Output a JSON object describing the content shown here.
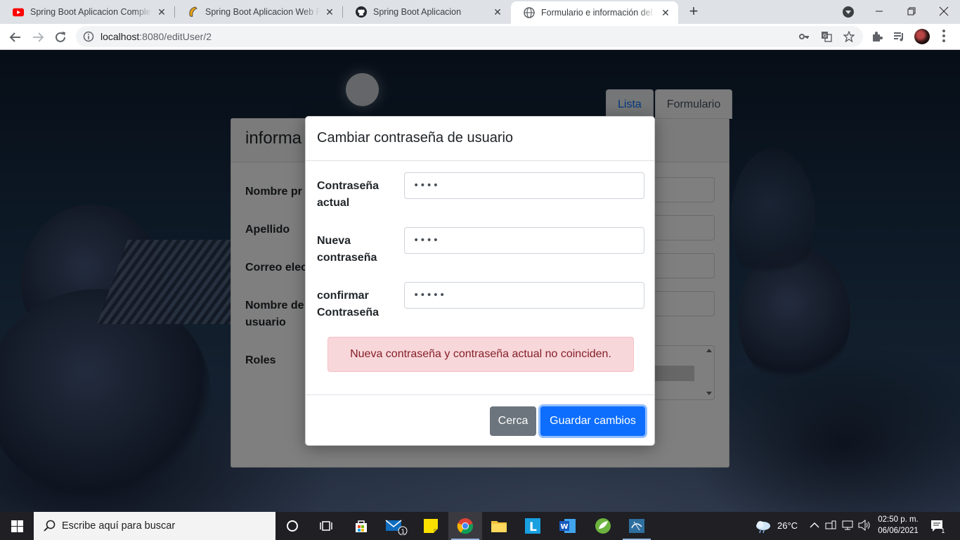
{
  "browser": {
    "tabs": [
      {
        "title": "Spring Boot Aplicacion Completa",
        "icon": "youtube-icon"
      },
      {
        "title": "Spring Boot Aplicacion Web Parte",
        "icon": "blog-icon"
      },
      {
        "title": "Spring Boot Aplicacion",
        "icon": "github-icon"
      },
      {
        "title": "Formulario e información del usuario",
        "icon": "globe-icon",
        "active": true
      }
    ],
    "url_host": "localhost",
    "url_rest": ":8080/editUser/2"
  },
  "page": {
    "tab_list": "Lista",
    "tab_form": "Formulario",
    "card_title": "informa",
    "fields": [
      "Nombre pr",
      "Apellido",
      "Correo elec",
      "Nombre de usuario",
      "Roles"
    ]
  },
  "modal": {
    "title": "Cambiar contraseña de usuario",
    "current_label": "Contraseña actual",
    "current_value": "••••",
    "new_label": "Nueva contraseña",
    "new_value": "••••",
    "confirm_label": "confirmar Contraseña",
    "confirm_value": "•••••",
    "error": "Nueva contraseña y contraseña actual no coinciden.",
    "close_button": "Cerca",
    "save_button": "Guardar cambios"
  },
  "taskbar": {
    "search_placeholder": "Escribe aquí para buscar",
    "weather": "26°C",
    "time": "02:50 p. m.",
    "date": "06/06/2021",
    "mail_badge": "1",
    "notifications": "1"
  },
  "colors": {
    "primary": "#0d6efd",
    "secondary": "#6c757d",
    "alert_bg": "#f8d7da",
    "alert_text": "#842029"
  }
}
